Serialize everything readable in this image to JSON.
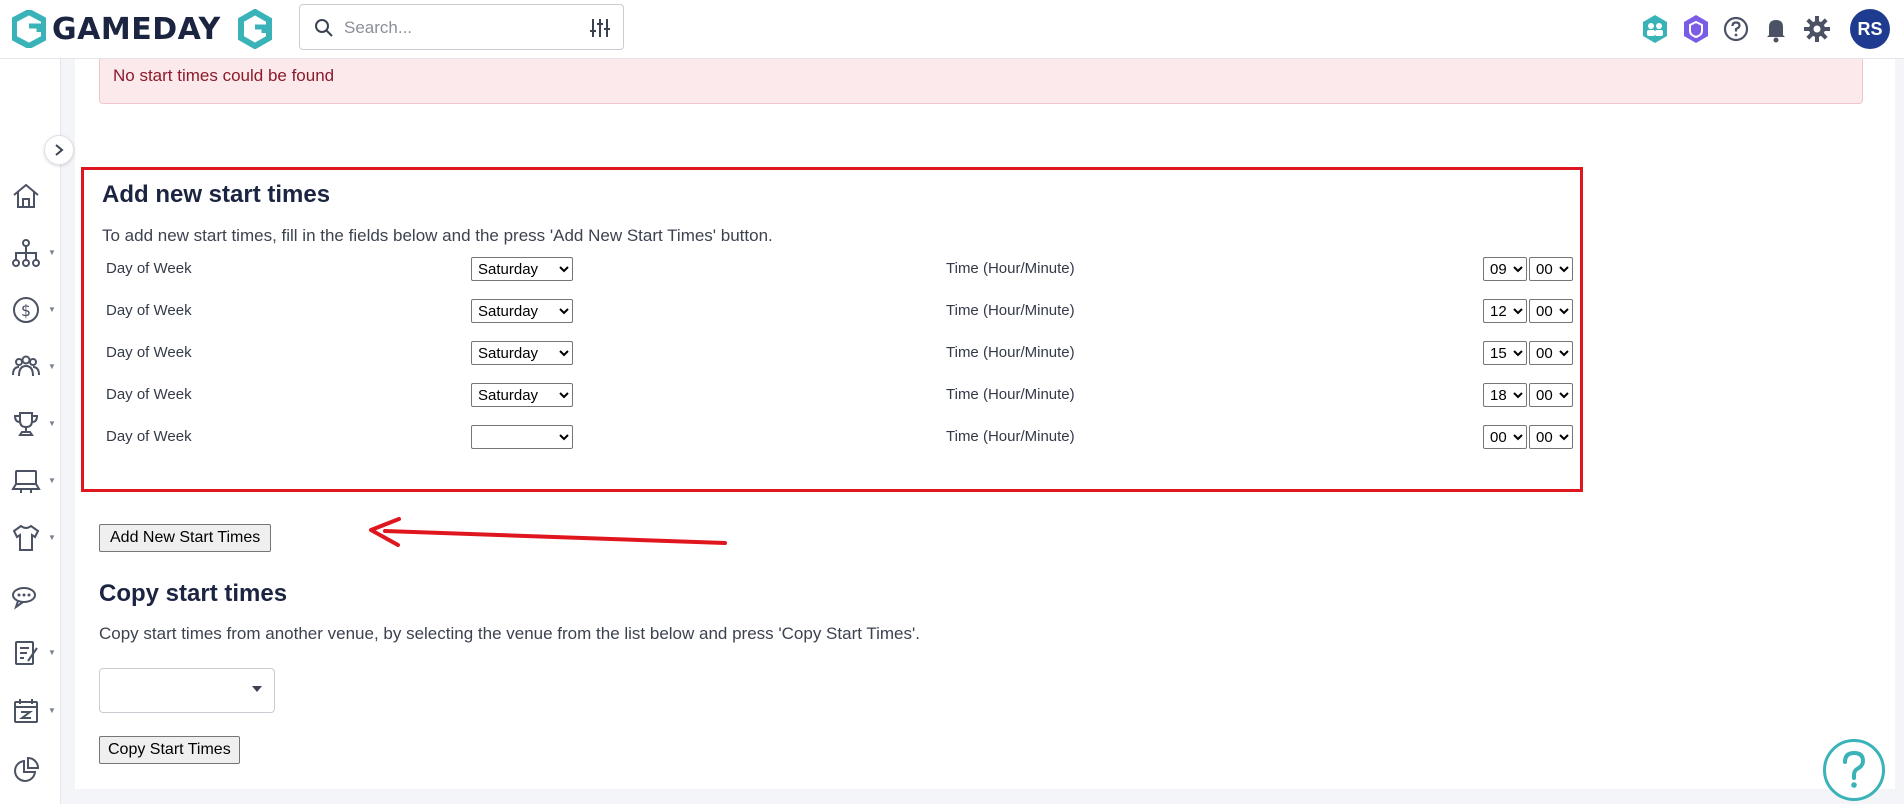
{
  "app": {
    "brand": "GAMEDAY",
    "brand_color": "#3ab3b8",
    "accent_dark": "#1b2440"
  },
  "header": {
    "search_placeholder": "Search...",
    "avatar_initials": "RS",
    "icons": [
      "members-icon",
      "shield-app-icon",
      "help-icon",
      "bell-icon",
      "gear-icon"
    ]
  },
  "sidebar": {
    "items": [
      {
        "icon": "home-icon"
      },
      {
        "icon": "org-chart-icon"
      },
      {
        "icon": "dollar-icon"
      },
      {
        "icon": "people-icon"
      },
      {
        "icon": "trophy-icon"
      },
      {
        "icon": "venue-icon"
      },
      {
        "icon": "jersey-icon"
      },
      {
        "icon": "chat-icon"
      },
      {
        "icon": "report-icon"
      },
      {
        "icon": "calendar-icon"
      },
      {
        "icon": "pie-chart-icon"
      }
    ]
  },
  "alert": {
    "text": "No start times could be found"
  },
  "add_section": {
    "title": "Add new start times",
    "description": "To add new start times, fill in the fields below and the press 'Add New Start Times' button.",
    "day_label": "Day of Week",
    "time_label": "Time (Hour/Minute)",
    "rows": [
      {
        "day": "Saturday",
        "hour": "09",
        "minute": "00"
      },
      {
        "day": "Saturday",
        "hour": "12",
        "minute": "00"
      },
      {
        "day": "Saturday",
        "hour": "15",
        "minute": "00"
      },
      {
        "day": "Saturday",
        "hour": "18",
        "minute": "00"
      },
      {
        "day": "",
        "hour": "00",
        "minute": "00"
      }
    ],
    "button": "Add New Start Times"
  },
  "copy_section": {
    "title": "Copy start times",
    "description": "Copy start times from another venue, by selecting the venue from the list below and press 'Copy Start Times'.",
    "venue_value": "",
    "button": "Copy Start Times"
  }
}
